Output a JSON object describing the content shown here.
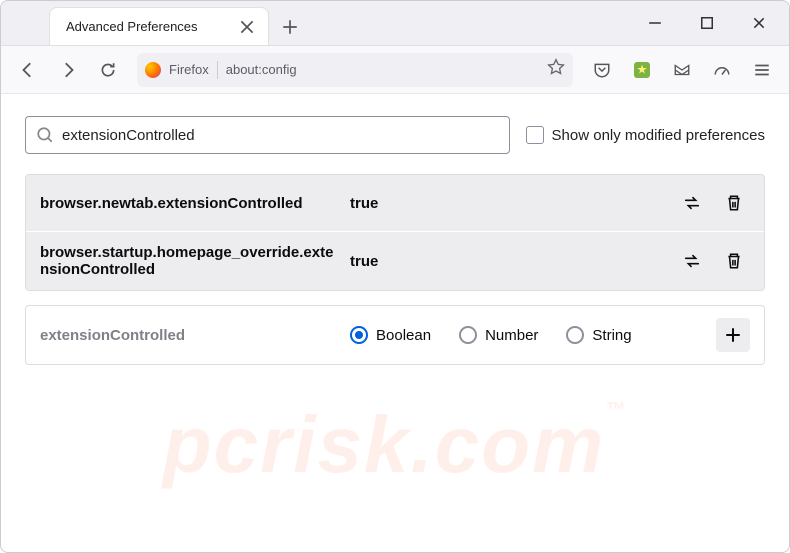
{
  "tab": {
    "title": "Advanced Preferences"
  },
  "addressbar": {
    "label": "Firefox",
    "url": "about:config"
  },
  "search": {
    "value": "extensionControlled",
    "checkbox_label": "Show only modified preferences"
  },
  "prefs": [
    {
      "name": "browser.newtab.extensionControlled",
      "value": "true"
    },
    {
      "name": "browser.startup.homepage_override.extensionControlled",
      "value": "true"
    }
  ],
  "new_pref": {
    "name": "extensionControlled",
    "types": [
      "Boolean",
      "Number",
      "String"
    ],
    "selected": "Boolean"
  },
  "watermark": "pcrisk.com"
}
